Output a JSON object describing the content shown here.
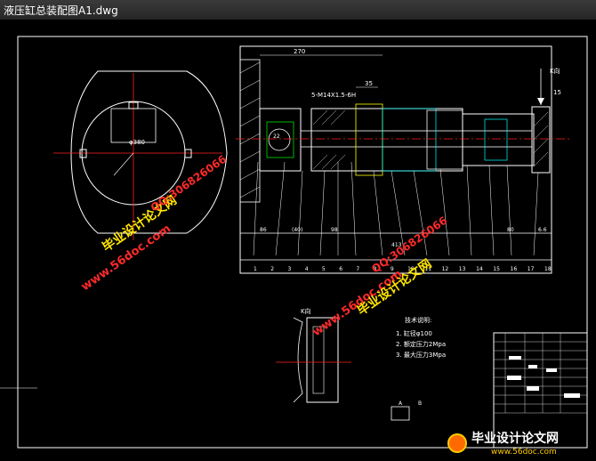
{
  "window": {
    "title": "液压缸总装配图A1.dwg"
  },
  "drawing": {
    "dims": {
      "d270": "270",
      "d35": "35",
      "thread": "5-M14X1.5-6H",
      "phi380": "φ380",
      "kdir": "K向",
      "d15": "15",
      "d22": "22",
      "d40": "(40)",
      "d98": "98",
      "d86": "86",
      "d80": "80",
      "d66": "6.6",
      "d413": "413"
    },
    "part_numbers": [
      "1",
      "2",
      "3",
      "4",
      "5",
      "6",
      "7",
      "8",
      "9",
      "10",
      "11",
      "12",
      "13",
      "14",
      "15",
      "16",
      "17",
      "18"
    ],
    "view_label": "K向",
    "notes": {
      "title": "技术说明:",
      "items": [
        "1. 缸径φ100",
        "2. 额定压力2Mpa",
        "3. 最大压力3Mpa"
      ]
    },
    "ab_label": {
      "a": "A",
      "b": "B"
    }
  },
  "watermarks": {
    "site1": "毕业设计论文网",
    "url": "www.56doc.com",
    "qq": "QQ:306826066",
    "footer_cn": "毕业设计论文网",
    "footer_url": "www.56doc.com"
  },
  "colors": {
    "background": "#000000",
    "line": "#ffffff",
    "center": "#ff2020",
    "yellow": "#ffff00",
    "cyan": "#00ffff",
    "green": "#00ff00",
    "wm_red": "#ff2a2a",
    "wm_yellow": "#ffe600"
  }
}
